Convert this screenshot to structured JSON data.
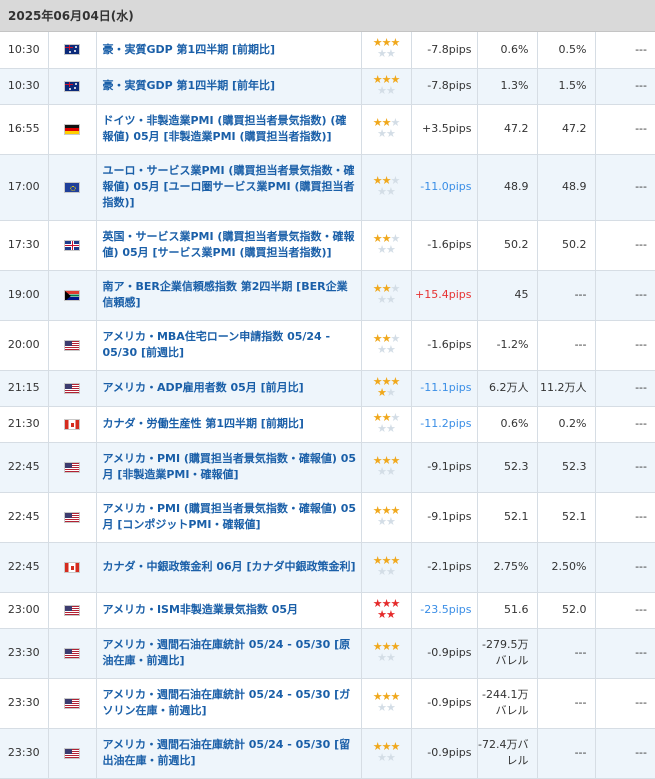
{
  "date_header": "2025年06月04日(水)",
  "rows": [
    {
      "time": "10:30",
      "country": "au",
      "flag_icon": "australia-flag-icon",
      "name": "豪・実質GDP 第1四半期 [前期比]",
      "importance": 3,
      "stars_style": "normal",
      "pips": "-7.8pips",
      "pips_color": "plain",
      "previous": "0.6%",
      "forecast": "0.5%",
      "result": "---"
    },
    {
      "time": "10:30",
      "country": "au",
      "flag_icon": "australia-flag-icon",
      "name": "豪・実質GDP 第1四半期 [前年比]",
      "importance": 3,
      "stars_style": "normal",
      "pips": "-7.8pips",
      "pips_color": "plain",
      "previous": "1.3%",
      "forecast": "1.5%",
      "result": "---"
    },
    {
      "time": "16:55",
      "country": "de",
      "flag_icon": "germany-flag-icon",
      "name": "ドイツ・非製造業PMI (購買担当者景気指数) (確報値) 05月 [非製造業PMI (購買担当者指数)]",
      "importance": 2,
      "stars_style": "normal",
      "pips": "+3.5pips",
      "pips_color": "plain",
      "previous": "47.2",
      "forecast": "47.2",
      "result": "---"
    },
    {
      "time": "17:00",
      "country": "eu",
      "flag_icon": "eu-flag-icon",
      "name": "ユーロ・サービス業PMI (購買担当者景気指数・確報値) 05月 [ユーロ圏サービス業PMI (購買担当者指数)]",
      "importance": 2,
      "stars_style": "normal",
      "pips": "-11.0pips",
      "pips_color": "blue",
      "previous": "48.9",
      "forecast": "48.9",
      "result": "---"
    },
    {
      "time": "17:30",
      "country": "uk",
      "flag_icon": "uk-flag-icon",
      "name": "英国・サービス業PMI (購買担当者景気指数・確報値) 05月 [サービス業PMI (購買担当者指数)]",
      "importance": 2,
      "stars_style": "normal",
      "pips": "-1.6pips",
      "pips_color": "plain",
      "previous": "50.2",
      "forecast": "50.2",
      "result": "---"
    },
    {
      "time": "19:00",
      "country": "za",
      "flag_icon": "south-africa-flag-icon",
      "name": "南ア・BER企業信頼感指数 第2四半期 [BER企業信頼感]",
      "importance": 2,
      "stars_style": "normal",
      "pips": "+15.4pips",
      "pips_color": "red",
      "previous": "45",
      "forecast": "---",
      "result": "---"
    },
    {
      "time": "20:00",
      "country": "us",
      "flag_icon": "usa-flag-icon",
      "name": "アメリカ・MBA住宅ローン申請指数 05/24 - 05/30 [前週比]",
      "importance": 2,
      "stars_style": "normal",
      "pips": "-1.6pips",
      "pips_color": "plain",
      "previous": "-1.2%",
      "forecast": "---",
      "result": "---"
    },
    {
      "time": "21:15",
      "country": "us",
      "flag_icon": "usa-flag-icon",
      "name": "アメリカ・ADP雇用者数 05月 [前月比]",
      "importance": 4,
      "stars_style": "normal",
      "pips": "-11.1pips",
      "pips_color": "blue",
      "previous": "6.2万人",
      "forecast": "11.2万人",
      "result": "---"
    },
    {
      "time": "21:30",
      "country": "ca",
      "flag_icon": "canada-flag-icon",
      "name": "カナダ・労働生産性 第1四半期 [前期比]",
      "importance": 2,
      "stars_style": "normal",
      "pips": "-11.2pips",
      "pips_color": "blue",
      "previous": "0.6%",
      "forecast": "0.2%",
      "result": "---"
    },
    {
      "time": "22:45",
      "country": "us",
      "flag_icon": "usa-flag-icon",
      "name": "アメリカ・PMI (購買担当者景気指数・確報値) 05月 [非製造業PMI・確報値]",
      "importance": 3,
      "stars_style": "normal",
      "pips": "-9.1pips",
      "pips_color": "plain",
      "previous": "52.3",
      "forecast": "52.3",
      "result": "---"
    },
    {
      "time": "22:45",
      "country": "us",
      "flag_icon": "usa-flag-icon",
      "name": "アメリカ・PMI (購買担当者景気指数・確報値) 05月 [コンポジットPMI・確報値]",
      "importance": 3,
      "stars_style": "normal",
      "pips": "-9.1pips",
      "pips_color": "plain",
      "previous": "52.1",
      "forecast": "52.1",
      "result": "---"
    },
    {
      "time": "22:45",
      "country": "ca",
      "flag_icon": "canada-flag-icon",
      "name": "カナダ・中銀政策金利 06月 [カナダ中銀政策金利]",
      "importance": 3,
      "stars_style": "normal",
      "pips": "-2.1pips",
      "pips_color": "plain",
      "previous": "2.75%",
      "forecast": "2.50%",
      "result": "---"
    },
    {
      "time": "23:00",
      "country": "us",
      "flag_icon": "usa-flag-icon",
      "name": "アメリカ・ISM非製造業景気指数 05月",
      "importance": 5,
      "stars_style": "red",
      "pips": "-23.5pips",
      "pips_color": "blue",
      "previous": "51.6",
      "forecast": "52.0",
      "result": "---"
    },
    {
      "time": "23:30",
      "country": "us",
      "flag_icon": "usa-flag-icon",
      "name": "アメリカ・週間石油在庫統計 05/24 - 05/30 [原油在庫・前週比]",
      "importance": 3,
      "stars_style": "normal",
      "pips": "-0.9pips",
      "pips_color": "plain",
      "previous": "-279.5万バレル",
      "forecast": "---",
      "result": "---"
    },
    {
      "time": "23:30",
      "country": "us",
      "flag_icon": "usa-flag-icon",
      "name": "アメリカ・週間石油在庫統計 05/24 - 05/30 [ガソリン在庫・前週比]",
      "importance": 3,
      "stars_style": "normal",
      "pips": "-0.9pips",
      "pips_color": "plain",
      "previous": "-244.1万バレル",
      "forecast": "---",
      "result": "---"
    },
    {
      "time": "23:30",
      "country": "us",
      "flag_icon": "usa-flag-icon",
      "name": "アメリカ・週間石油在庫統計 05/24 - 05/30 [留出油在庫・前週比]",
      "importance": 3,
      "stars_style": "normal",
      "pips": "-0.9pips",
      "pips_color": "plain",
      "previous": "-72.4万バレル",
      "forecast": "---",
      "result": "---"
    }
  ]
}
